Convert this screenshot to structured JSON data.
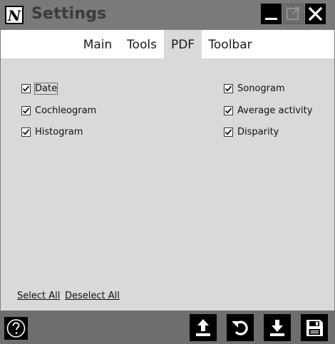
{
  "window": {
    "title": "Settings",
    "app_icon_letter": "N"
  },
  "titlebar_buttons": {
    "minimize_icon": "minimize-icon",
    "maximize_icon": "maximize-icon",
    "close_icon": "close-icon"
  },
  "tabs": [
    {
      "label": "Main",
      "active": false
    },
    {
      "label": "Tools",
      "active": false
    },
    {
      "label": "PDF",
      "active": true
    },
    {
      "label": "Toolbar",
      "active": false
    }
  ],
  "pdf_options": {
    "left": [
      {
        "label": "Date",
        "checked": true
      },
      {
        "label": "Cochleogram",
        "checked": true
      },
      {
        "label": "Histogram",
        "checked": true
      }
    ],
    "right": [
      {
        "label": "Sonogram",
        "checked": true
      },
      {
        "label": "Average activity",
        "checked": true
      },
      {
        "label": "Disparity",
        "checked": true
      }
    ]
  },
  "links": {
    "select_all": "Select All",
    "deselect_all": "Deselect All"
  },
  "footer": {
    "help_icon": "help-icon",
    "upload_icon": "upload-icon",
    "reset_icon": "reset-icon",
    "download_icon": "download-icon",
    "save_icon": "save-icon"
  },
  "colors": {
    "titlebar": "#7a7a7a",
    "content_bg": "#d9d9d9",
    "tabstrip_bg": "#ffffff",
    "footer_bg": "#6e6e6e",
    "button_bg": "#000000"
  }
}
